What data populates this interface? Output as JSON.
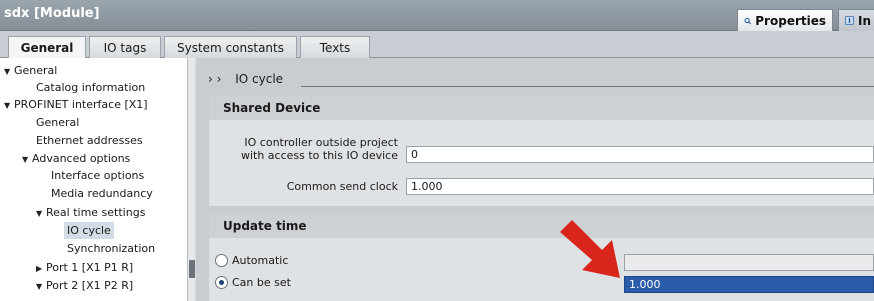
{
  "window": {
    "title": "sdx [Module]"
  },
  "inspector_tabs": {
    "properties": "Properties",
    "info": "In"
  },
  "tabs": [
    "General",
    "IO tags",
    "System constants",
    "Texts"
  ],
  "nav": {
    "items": [
      {
        "label": "General",
        "expanded": true
      },
      {
        "label": "Catalog information"
      },
      {
        "label": "PROFINET interface [X1]",
        "expanded": true
      },
      {
        "label": "General"
      },
      {
        "label": "Ethernet addresses"
      },
      {
        "label": "Advanced options",
        "expanded": true
      },
      {
        "label": "Interface options"
      },
      {
        "label": "Media redundancy"
      },
      {
        "label": "Real time settings",
        "expanded": true
      },
      {
        "label": "IO cycle",
        "selected": true
      },
      {
        "label": "Synchronization"
      },
      {
        "label": "Port 1 [X1 P1 R]",
        "expanded": false
      },
      {
        "label": "Port 2 [X1 P2 R]",
        "expanded": true
      }
    ]
  },
  "breadcrumb": {
    "arrows": "› ›",
    "label": "IO cycle"
  },
  "shared_device": {
    "title": "Shared Device",
    "io_controller_label_1": "IO controller outside project",
    "io_controller_label_2": "with access to this IO device",
    "io_controller_value": "0",
    "send_clock_label": "Common send clock",
    "send_clock_value": "1.000"
  },
  "update_time": {
    "title": "Update time",
    "automatic_label": "Automatic",
    "automatic_value": "",
    "can_be_set_label": "Can be set",
    "can_be_set_value": "1.000",
    "selected": "Can be set"
  },
  "colors": {
    "highlight": "#2a5caa",
    "arrow": "#d9261c"
  }
}
